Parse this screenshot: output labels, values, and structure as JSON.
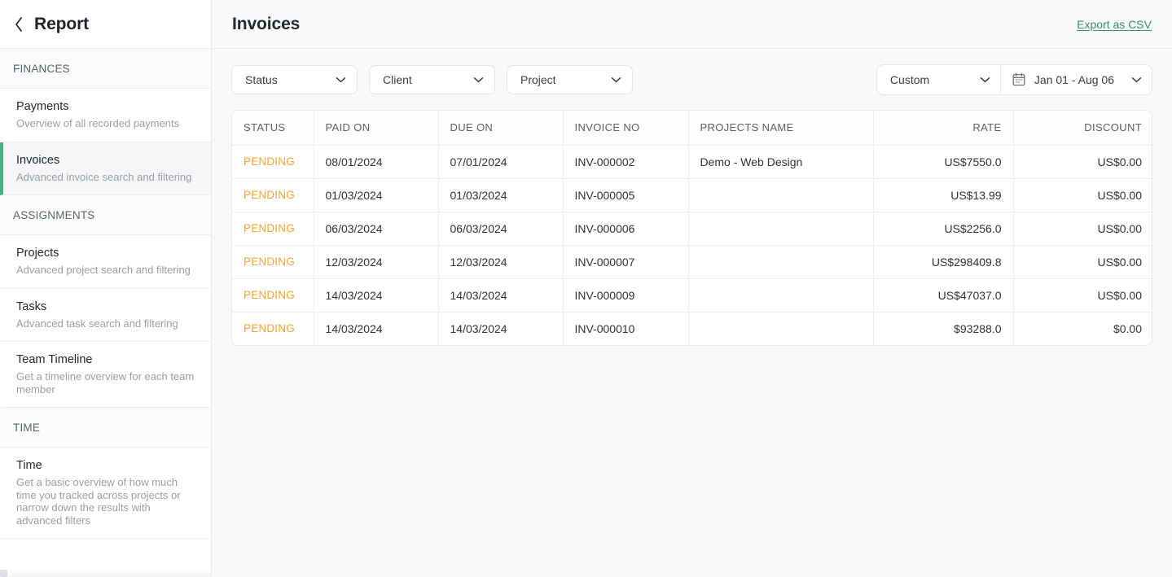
{
  "sidebar": {
    "back_icon": "chevron-left-icon",
    "title": "Report",
    "sections": [
      {
        "label": "FINANCES",
        "items": [
          {
            "title": "Payments",
            "desc": "Overview of all recorded payments",
            "active": false
          },
          {
            "title": "Invoices",
            "desc": "Advanced invoice search and filtering",
            "active": true
          }
        ]
      },
      {
        "label": "ASSIGNMENTS",
        "items": [
          {
            "title": "Projects",
            "desc": "Advanced project search and filtering",
            "active": false
          },
          {
            "title": "Tasks",
            "desc": "Advanced task search and filtering",
            "active": false
          },
          {
            "title": "Team Timeline",
            "desc": "Get a timeline overview for each team member",
            "active": false
          }
        ]
      },
      {
        "label": "TIME",
        "items": [
          {
            "title": "Time",
            "desc": "Get a basic overview of how much time you tracked across projects or narrow down the results with advanced filters",
            "active": false
          }
        ]
      }
    ]
  },
  "header": {
    "title": "Invoices",
    "export_label": "Export as CSV"
  },
  "filters": {
    "status": {
      "label": "Status",
      "icon": "chevron-down-icon"
    },
    "client": {
      "label": "Client",
      "icon": "chevron-down-icon"
    },
    "project": {
      "label": "Project",
      "icon": "chevron-down-icon"
    },
    "range_preset": {
      "label": "Custom",
      "icon": "chevron-down-icon"
    },
    "date_range": {
      "label": "Jan 01 - Aug 06",
      "icon": "calendar-icon",
      "chevron": "chevron-down-icon"
    }
  },
  "table": {
    "columns": [
      {
        "key": "status",
        "label": "STATUS",
        "align": "left"
      },
      {
        "key": "paid_on",
        "label": "PAID ON",
        "align": "left"
      },
      {
        "key": "due_on",
        "label": "DUE ON",
        "align": "left"
      },
      {
        "key": "invoice_no",
        "label": "INVOICE NO",
        "align": "left"
      },
      {
        "key": "projects_name",
        "label": "PROJECTS NAME",
        "align": "left"
      },
      {
        "key": "rate",
        "label": "RATE",
        "align": "right"
      },
      {
        "key": "discount",
        "label": "DISCOUNT",
        "align": "right"
      }
    ],
    "rows": [
      {
        "status": "PENDING",
        "paid_on": "08/01/2024",
        "due_on": "07/01/2024",
        "invoice_no": "INV-000002",
        "projects_name": "Demo - Web Design",
        "rate": "US$7550.0",
        "discount": "US$0.00"
      },
      {
        "status": "PENDING",
        "paid_on": "01/03/2024",
        "due_on": "01/03/2024",
        "invoice_no": "INV-000005",
        "projects_name": "",
        "rate": "US$13.99",
        "discount": "US$0.00"
      },
      {
        "status": "PENDING",
        "paid_on": "06/03/2024",
        "due_on": "06/03/2024",
        "invoice_no": "INV-000006",
        "projects_name": "",
        "rate": "US$2256.0",
        "discount": "US$0.00"
      },
      {
        "status": "PENDING",
        "paid_on": "12/03/2024",
        "due_on": "12/03/2024",
        "invoice_no": "INV-000007",
        "projects_name": "",
        "rate": "US$298409.8",
        "discount": "US$0.00"
      },
      {
        "status": "PENDING",
        "paid_on": "14/03/2024",
        "due_on": "14/03/2024",
        "invoice_no": "INV-000009",
        "projects_name": "",
        "rate": "US$47037.0",
        "discount": "US$0.00"
      },
      {
        "status": "PENDING",
        "paid_on": "14/03/2024",
        "due_on": "14/03/2024",
        "invoice_no": "INV-000010",
        "projects_name": "",
        "rate": "$93288.0",
        "discount": "$0.00"
      }
    ]
  },
  "colors": {
    "accent_green": "#4caf82",
    "link_green": "#3f8f62",
    "status_pending": "#f3a333",
    "page_bg": "#f7f8f8"
  }
}
